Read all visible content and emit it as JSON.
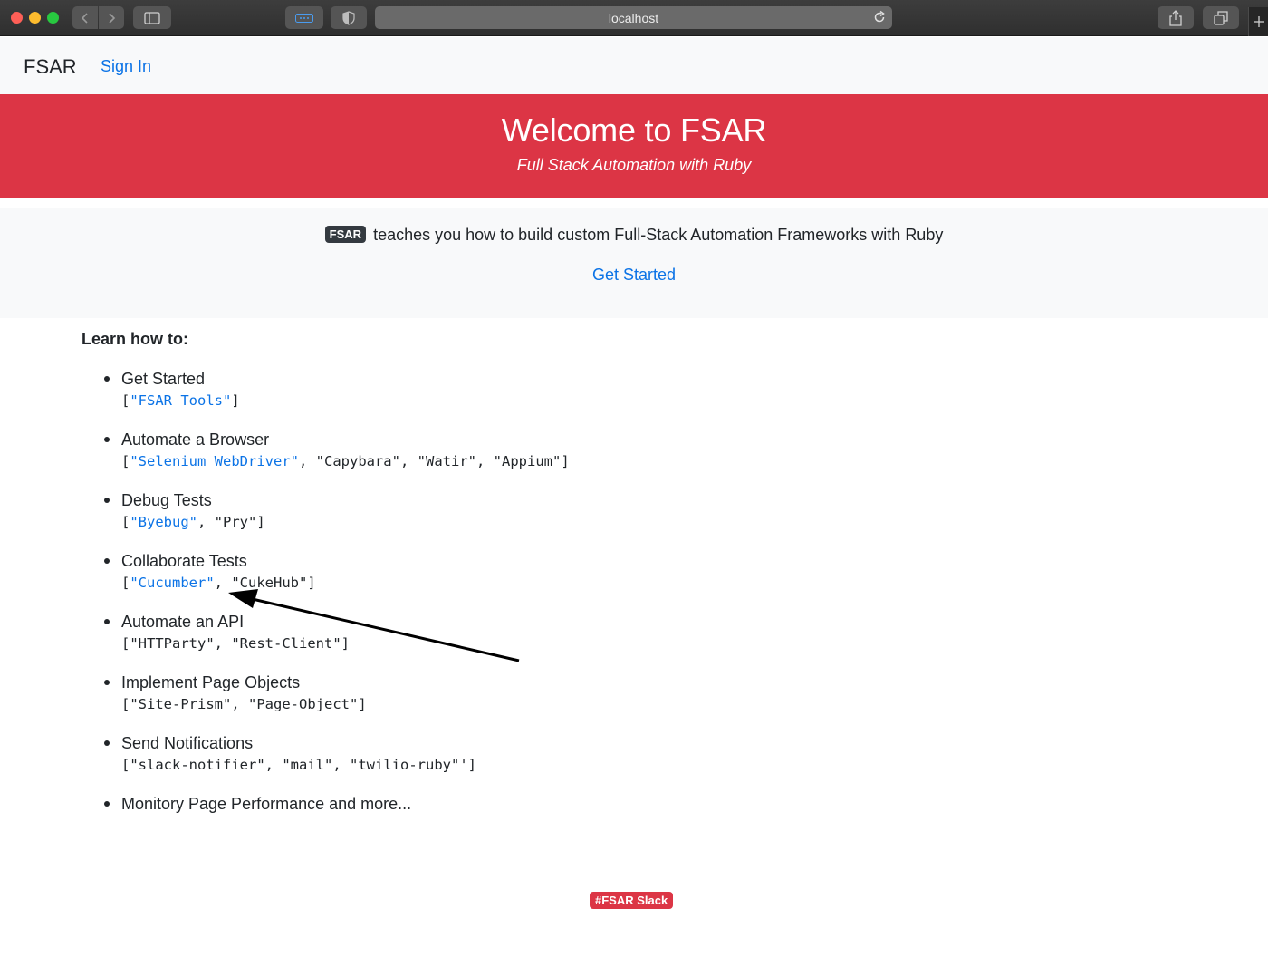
{
  "browser": {
    "url": "localhost"
  },
  "navbar": {
    "brand": "FSAR",
    "sign_in": "Sign In"
  },
  "hero": {
    "title": "Welcome to FSAR",
    "subtitle": "Full Stack Automation with Ruby"
  },
  "intro": {
    "badge": "FSAR",
    "text": "teaches you how to build custom Full-Stack Automation Frameworks with Ruby",
    "cta": "Get Started"
  },
  "learn": {
    "heading": "Learn how to:",
    "items": [
      {
        "title": "Get Started",
        "tools": [
          "FSAR Tools"
        ],
        "linked": 1,
        "tail": ""
      },
      {
        "title": "Automate a Browser",
        "tools": [
          "Selenium WebDriver",
          "Capybara",
          "Watir",
          "Appium"
        ],
        "linked": 1,
        "tail": ""
      },
      {
        "title": "Debug Tests",
        "tools": [
          "Byebug",
          "Pry"
        ],
        "linked": 1,
        "tail": ""
      },
      {
        "title": "Collaborate Tests",
        "tools": [
          "Cucumber",
          "CukeHub"
        ],
        "linked": 1,
        "tail": ""
      },
      {
        "title": "Automate an API",
        "tools": [
          "HTTParty",
          "Rest-Client"
        ],
        "linked": 0,
        "tail": ""
      },
      {
        "title": "Implement Page Objects",
        "tools": [
          "Site-Prism",
          "Page-Object"
        ],
        "linked": 0,
        "tail": ""
      },
      {
        "title": "Send Notifications",
        "tools": [
          "slack-notifier",
          "mail",
          "twilio-ruby"
        ],
        "linked": 0,
        "tail": "'"
      },
      {
        "title": "Monitory Page Performance and more...",
        "tools": [],
        "linked": 0,
        "tail": ""
      }
    ]
  },
  "footer": {
    "slack_badge": "#FSAR Slack"
  },
  "colors": {
    "danger": "#dc3545",
    "link": "#0b73e6",
    "dark_badge": "#343a40",
    "light_bg": "#f8f9fa"
  },
  "icons": [
    "back-icon",
    "forward-icon",
    "sidebar-icon",
    "password-icon",
    "privacy-shield-icon",
    "reload-icon",
    "share-icon",
    "tabs-overview-icon",
    "new-tab-plus-icon"
  ]
}
